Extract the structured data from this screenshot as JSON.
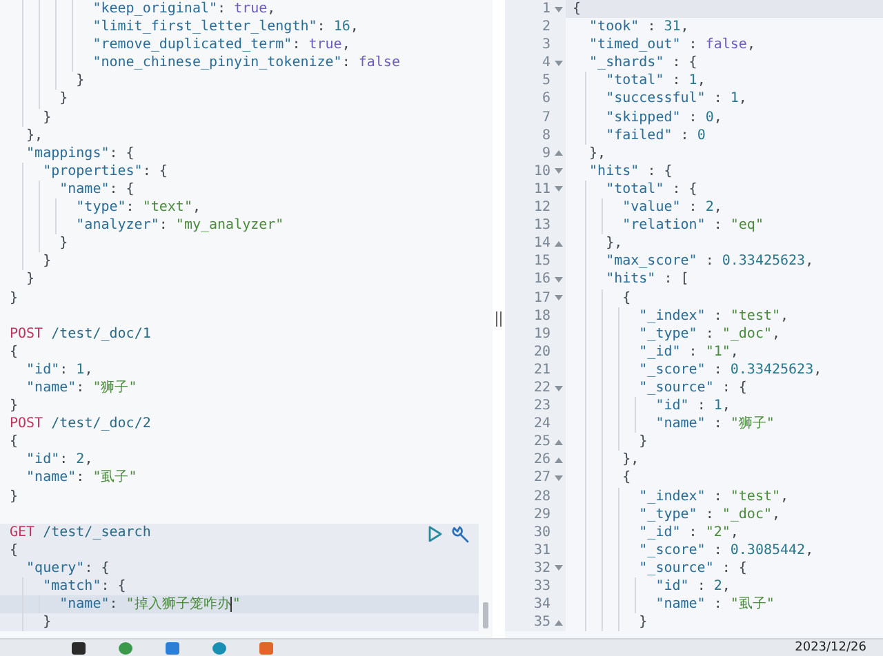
{
  "request_editor": {
    "blocks": [
      {
        "active": false,
        "lines": [
          {
            "tokens": [
              {
                "kind": "key",
                "text": "          \"keep_original\""
              },
              {
                "kind": "punct",
                "text": ": "
              },
              {
                "kind": "bool",
                "text": "true"
              },
              {
                "kind": "punct",
                "text": ","
              }
            ]
          },
          {
            "tokens": [
              {
                "kind": "key",
                "text": "          \"limit_first_letter_length\""
              },
              {
                "kind": "punct",
                "text": ": "
              },
              {
                "kind": "number",
                "text": "16"
              },
              {
                "kind": "punct",
                "text": ","
              }
            ]
          },
          {
            "tokens": [
              {
                "kind": "key",
                "text": "          \"remove_duplicated_term\""
              },
              {
                "kind": "punct",
                "text": ": "
              },
              {
                "kind": "bool",
                "text": "true"
              },
              {
                "kind": "punct",
                "text": ","
              }
            ]
          },
          {
            "tokens": [
              {
                "kind": "key",
                "text": "          \"none_chinese_pinyin_tokenize\""
              },
              {
                "kind": "punct",
                "text": ": "
              },
              {
                "kind": "bool",
                "text": "false"
              }
            ]
          },
          {
            "tokens": [
              {
                "kind": "punct",
                "text": "        }"
              }
            ]
          },
          {
            "tokens": [
              {
                "kind": "punct",
                "text": "      }"
              }
            ]
          },
          {
            "tokens": [
              {
                "kind": "punct",
                "text": "    }"
              }
            ]
          },
          {
            "tokens": [
              {
                "kind": "punct",
                "text": "  },"
              }
            ]
          },
          {
            "tokens": [
              {
                "kind": "key",
                "text": "  \"mappings\""
              },
              {
                "kind": "punct",
                "text": ": {"
              }
            ]
          },
          {
            "tokens": [
              {
                "kind": "key",
                "text": "    \"properties\""
              },
              {
                "kind": "punct",
                "text": ": {"
              }
            ]
          },
          {
            "tokens": [
              {
                "kind": "key",
                "text": "      \"name\""
              },
              {
                "kind": "punct",
                "text": ": {"
              }
            ]
          },
          {
            "tokens": [
              {
                "kind": "key",
                "text": "        \"type\""
              },
              {
                "kind": "punct",
                "text": ": "
              },
              {
                "kind": "string",
                "text": "\"text\""
              },
              {
                "kind": "punct",
                "text": ","
              }
            ]
          },
          {
            "tokens": [
              {
                "kind": "key",
                "text": "        \"analyzer\""
              },
              {
                "kind": "punct",
                "text": ": "
              },
              {
                "kind": "string",
                "text": "\"my_analyzer\""
              }
            ]
          },
          {
            "tokens": [
              {
                "kind": "punct",
                "text": "      }"
              }
            ]
          },
          {
            "tokens": [
              {
                "kind": "punct",
                "text": "    }"
              }
            ]
          },
          {
            "tokens": [
              {
                "kind": "punct",
                "text": "  }"
              }
            ]
          },
          {
            "tokens": [
              {
                "kind": "punct",
                "text": "}"
              }
            ]
          }
        ]
      },
      {
        "active": false,
        "lines": [
          {
            "tokens": [
              {
                "kind": "method",
                "text": "POST"
              },
              {
                "kind": "path",
                "text": " /test/_doc/1"
              }
            ]
          },
          {
            "tokens": [
              {
                "kind": "punct",
                "text": "{"
              }
            ]
          },
          {
            "tokens": [
              {
                "kind": "key",
                "text": "  \"id\""
              },
              {
                "kind": "punct",
                "text": ": "
              },
              {
                "kind": "number",
                "text": "1"
              },
              {
                "kind": "punct",
                "text": ","
              }
            ]
          },
          {
            "tokens": [
              {
                "kind": "key",
                "text": "  \"name\""
              },
              {
                "kind": "punct",
                "text": ": "
              },
              {
                "kind": "string",
                "text": "\"狮子\""
              }
            ]
          },
          {
            "tokens": [
              {
                "kind": "punct",
                "text": "}"
              }
            ]
          },
          {
            "tokens": [
              {
                "kind": "method",
                "text": "POST"
              },
              {
                "kind": "path",
                "text": " /test/_doc/2"
              }
            ]
          },
          {
            "tokens": [
              {
                "kind": "punct",
                "text": "{"
              }
            ]
          },
          {
            "tokens": [
              {
                "kind": "key",
                "text": "  \"id\""
              },
              {
                "kind": "punct",
                "text": ": "
              },
              {
                "kind": "number",
                "text": "2"
              },
              {
                "kind": "punct",
                "text": ","
              }
            ]
          },
          {
            "tokens": [
              {
                "kind": "key",
                "text": "  \"name\""
              },
              {
                "kind": "punct",
                "text": ": "
              },
              {
                "kind": "string",
                "text": "\"虱子\""
              }
            ]
          },
          {
            "tokens": [
              {
                "kind": "punct",
                "text": "}"
              }
            ]
          }
        ]
      },
      {
        "active": true,
        "lines": [
          {
            "cursor": false,
            "tokens": [
              {
                "kind": "method",
                "text": "GET"
              },
              {
                "kind": "path",
                "text": " /test/_search"
              }
            ]
          },
          {
            "cursor": false,
            "tokens": [
              {
                "kind": "punct",
                "text": "{"
              }
            ]
          },
          {
            "cursor": false,
            "tokens": [
              {
                "kind": "key",
                "text": "  \"query\""
              },
              {
                "kind": "punct",
                "text": ": {"
              }
            ]
          },
          {
            "cursor": false,
            "tokens": [
              {
                "kind": "key",
                "text": "    \"match\""
              },
              {
                "kind": "punct",
                "text": ": {"
              }
            ]
          },
          {
            "cursor": true,
            "tokens": [
              {
                "kind": "key",
                "text": "      \"name\""
              },
              {
                "kind": "punct",
                "text": ": "
              },
              {
                "kind": "string",
                "text": "\"掉入狮子笼咋办"
              },
              {
                "kind": "string",
                "text": "\""
              }
            ]
          },
          {
            "cursor": false,
            "tokens": [
              {
                "kind": "punct",
                "text": "    }"
              }
            ]
          }
        ]
      }
    ]
  },
  "response_viewer": {
    "lines": [
      {
        "number": "1",
        "fold_open": true,
        "current": true,
        "tokens": [
          {
            "kind": "punct",
            "text": "{"
          }
        ]
      },
      {
        "number": "2",
        "current": false,
        "tokens": [
          {
            "kind": "key",
            "text": "  \"took\""
          },
          {
            "kind": "punct",
            "text": " : "
          },
          {
            "kind": "number",
            "text": "31"
          },
          {
            "kind": "punct",
            "text": ","
          }
        ]
      },
      {
        "number": "3",
        "current": false,
        "tokens": [
          {
            "kind": "key",
            "text": "  \"timed_out\""
          },
          {
            "kind": "punct",
            "text": " : "
          },
          {
            "kind": "bool",
            "text": "false"
          },
          {
            "kind": "punct",
            "text": ","
          }
        ]
      },
      {
        "number": "4",
        "fold_open": true,
        "current": false,
        "tokens": [
          {
            "kind": "key",
            "text": "  \"_shards\""
          },
          {
            "kind": "punct",
            "text": " : {"
          }
        ]
      },
      {
        "number": "5",
        "current": false,
        "tokens": [
          {
            "kind": "key",
            "text": "    \"total\""
          },
          {
            "kind": "punct",
            "text": " : "
          },
          {
            "kind": "number",
            "text": "1"
          },
          {
            "kind": "punct",
            "text": ","
          }
        ]
      },
      {
        "number": "6",
        "current": false,
        "tokens": [
          {
            "kind": "key",
            "text": "    \"successful\""
          },
          {
            "kind": "punct",
            "text": " : "
          },
          {
            "kind": "number",
            "text": "1"
          },
          {
            "kind": "punct",
            "text": ","
          }
        ]
      },
      {
        "number": "7",
        "current": false,
        "tokens": [
          {
            "kind": "key",
            "text": "    \"skipped\""
          },
          {
            "kind": "punct",
            "text": " : "
          },
          {
            "kind": "number",
            "text": "0"
          },
          {
            "kind": "punct",
            "text": ","
          }
        ]
      },
      {
        "number": "8",
        "current": false,
        "tokens": [
          {
            "kind": "key",
            "text": "    \"failed\""
          },
          {
            "kind": "punct",
            "text": " : "
          },
          {
            "kind": "number",
            "text": "0"
          }
        ]
      },
      {
        "number": "9",
        "fold_open": false,
        "current": false,
        "tokens": [
          {
            "kind": "punct",
            "text": "  },"
          }
        ]
      },
      {
        "number": "10",
        "fold_open": true,
        "current": false,
        "tokens": [
          {
            "kind": "key",
            "text": "  \"hits\""
          },
          {
            "kind": "punct",
            "text": " : {"
          }
        ]
      },
      {
        "number": "11",
        "fold_open": true,
        "current": false,
        "tokens": [
          {
            "kind": "key",
            "text": "    \"total\""
          },
          {
            "kind": "punct",
            "text": " : {"
          }
        ]
      },
      {
        "number": "12",
        "current": false,
        "tokens": [
          {
            "kind": "key",
            "text": "      \"value\""
          },
          {
            "kind": "punct",
            "text": " : "
          },
          {
            "kind": "number",
            "text": "2"
          },
          {
            "kind": "punct",
            "text": ","
          }
        ]
      },
      {
        "number": "13",
        "current": false,
        "tokens": [
          {
            "kind": "key",
            "text": "      \"relation\""
          },
          {
            "kind": "punct",
            "text": " : "
          },
          {
            "kind": "string",
            "text": "\"eq\""
          }
        ]
      },
      {
        "number": "14",
        "fold_open": false,
        "current": false,
        "tokens": [
          {
            "kind": "punct",
            "text": "    },"
          }
        ]
      },
      {
        "number": "15",
        "current": false,
        "tokens": [
          {
            "kind": "key",
            "text": "    \"max_score\""
          },
          {
            "kind": "punct",
            "text": " : "
          },
          {
            "kind": "number",
            "text": "0.33425623"
          },
          {
            "kind": "punct",
            "text": ","
          }
        ]
      },
      {
        "number": "16",
        "fold_open": true,
        "current": false,
        "tokens": [
          {
            "kind": "key",
            "text": "    \"hits\""
          },
          {
            "kind": "punct",
            "text": " : ["
          }
        ]
      },
      {
        "number": "17",
        "fold_open": true,
        "current": false,
        "tokens": [
          {
            "kind": "punct",
            "text": "      {"
          }
        ]
      },
      {
        "number": "18",
        "current": false,
        "tokens": [
          {
            "kind": "key",
            "text": "        \"_index\""
          },
          {
            "kind": "punct",
            "text": " : "
          },
          {
            "kind": "string",
            "text": "\"test\""
          },
          {
            "kind": "punct",
            "text": ","
          }
        ]
      },
      {
        "number": "19",
        "current": false,
        "tokens": [
          {
            "kind": "key",
            "text": "        \"_type\""
          },
          {
            "kind": "punct",
            "text": " : "
          },
          {
            "kind": "string",
            "text": "\"_doc\""
          },
          {
            "kind": "punct",
            "text": ","
          }
        ]
      },
      {
        "number": "20",
        "current": false,
        "tokens": [
          {
            "kind": "key",
            "text": "        \"_id\""
          },
          {
            "kind": "punct",
            "text": " : "
          },
          {
            "kind": "string",
            "text": "\"1\""
          },
          {
            "kind": "punct",
            "text": ","
          }
        ]
      },
      {
        "number": "21",
        "current": false,
        "tokens": [
          {
            "kind": "key",
            "text": "        \"_score\""
          },
          {
            "kind": "punct",
            "text": " : "
          },
          {
            "kind": "number",
            "text": "0.33425623"
          },
          {
            "kind": "punct",
            "text": ","
          }
        ]
      },
      {
        "number": "22",
        "fold_open": true,
        "current": false,
        "tokens": [
          {
            "kind": "key",
            "text": "        \"_source\""
          },
          {
            "kind": "punct",
            "text": " : {"
          }
        ]
      },
      {
        "number": "23",
        "current": false,
        "tokens": [
          {
            "kind": "key",
            "text": "          \"id\""
          },
          {
            "kind": "punct",
            "text": " : "
          },
          {
            "kind": "number",
            "text": "1"
          },
          {
            "kind": "punct",
            "text": ","
          }
        ]
      },
      {
        "number": "24",
        "current": false,
        "tokens": [
          {
            "kind": "key",
            "text": "          \"name\""
          },
          {
            "kind": "punct",
            "text": " : "
          },
          {
            "kind": "string",
            "text": "\"狮子\""
          }
        ]
      },
      {
        "number": "25",
        "fold_open": false,
        "current": false,
        "tokens": [
          {
            "kind": "punct",
            "text": "        }"
          }
        ]
      },
      {
        "number": "26",
        "fold_open": false,
        "current": false,
        "tokens": [
          {
            "kind": "punct",
            "text": "      },"
          }
        ]
      },
      {
        "number": "27",
        "fold_open": true,
        "current": false,
        "tokens": [
          {
            "kind": "punct",
            "text": "      {"
          }
        ]
      },
      {
        "number": "28",
        "current": false,
        "tokens": [
          {
            "kind": "key",
            "text": "        \"_index\""
          },
          {
            "kind": "punct",
            "text": " : "
          },
          {
            "kind": "string",
            "text": "\"test\""
          },
          {
            "kind": "punct",
            "text": ","
          }
        ]
      },
      {
        "number": "29",
        "current": false,
        "tokens": [
          {
            "kind": "key",
            "text": "        \"_type\""
          },
          {
            "kind": "punct",
            "text": " : "
          },
          {
            "kind": "string",
            "text": "\"_doc\""
          },
          {
            "kind": "punct",
            "text": ","
          }
        ]
      },
      {
        "number": "30",
        "current": false,
        "tokens": [
          {
            "kind": "key",
            "text": "        \"_id\""
          },
          {
            "kind": "punct",
            "text": " : "
          },
          {
            "kind": "string",
            "text": "\"2\""
          },
          {
            "kind": "punct",
            "text": ","
          }
        ]
      },
      {
        "number": "31",
        "current": false,
        "tokens": [
          {
            "kind": "key",
            "text": "        \"_score\""
          },
          {
            "kind": "punct",
            "text": " : "
          },
          {
            "kind": "number",
            "text": "0.3085442"
          },
          {
            "kind": "punct",
            "text": ","
          }
        ]
      },
      {
        "number": "32",
        "fold_open": true,
        "current": false,
        "tokens": [
          {
            "kind": "key",
            "text": "        \"_source\""
          },
          {
            "kind": "punct",
            "text": " : {"
          }
        ]
      },
      {
        "number": "33",
        "current": false,
        "tokens": [
          {
            "kind": "key",
            "text": "          \"id\""
          },
          {
            "kind": "punct",
            "text": " : "
          },
          {
            "kind": "number",
            "text": "2"
          },
          {
            "kind": "punct",
            "text": ","
          }
        ]
      },
      {
        "number": "34",
        "current": false,
        "tokens": [
          {
            "kind": "key",
            "text": "          \"name\""
          },
          {
            "kind": "punct",
            "text": " : "
          },
          {
            "kind": "string",
            "text": "\"虱子\""
          }
        ]
      },
      {
        "number": "35",
        "fold_open": false,
        "current": false,
        "tokens": [
          {
            "kind": "punct",
            "text": "        }"
          }
        ]
      }
    ]
  },
  "taskbar": {
    "clock": "2023/12/26"
  }
}
